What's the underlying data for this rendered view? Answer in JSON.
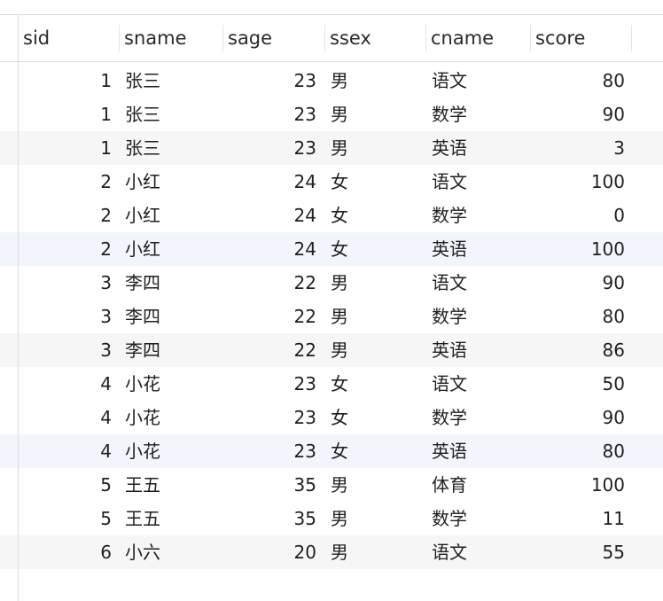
{
  "columns": [
    "sid",
    "sname",
    "sage",
    "ssex",
    "cname",
    "score"
  ],
  "rows": [
    {
      "sid": "1",
      "sname": "张三",
      "sage": "23",
      "ssex": "男",
      "cname": "语文",
      "score": "80"
    },
    {
      "sid": "1",
      "sname": "张三",
      "sage": "23",
      "ssex": "男",
      "cname": "数学",
      "score": "90"
    },
    {
      "sid": "1",
      "sname": "张三",
      "sage": "23",
      "ssex": "男",
      "cname": "英语",
      "score": "3"
    },
    {
      "sid": "2",
      "sname": "小红",
      "sage": "24",
      "ssex": "女",
      "cname": "语文",
      "score": "100"
    },
    {
      "sid": "2",
      "sname": "小红",
      "sage": "24",
      "ssex": "女",
      "cname": "数学",
      "score": "0"
    },
    {
      "sid": "2",
      "sname": "小红",
      "sage": "24",
      "ssex": "女",
      "cname": "英语",
      "score": "100"
    },
    {
      "sid": "3",
      "sname": "李四",
      "sage": "22",
      "ssex": "男",
      "cname": "语文",
      "score": "90"
    },
    {
      "sid": "3",
      "sname": "李四",
      "sage": "22",
      "ssex": "男",
      "cname": "数学",
      "score": "80"
    },
    {
      "sid": "3",
      "sname": "李四",
      "sage": "22",
      "ssex": "男",
      "cname": "英语",
      "score": "86"
    },
    {
      "sid": "4",
      "sname": "小花",
      "sage": "23",
      "ssex": "女",
      "cname": "语文",
      "score": "50"
    },
    {
      "sid": "4",
      "sname": "小花",
      "sage": "23",
      "ssex": "女",
      "cname": "数学",
      "score": "90"
    },
    {
      "sid": "4",
      "sname": "小花",
      "sage": "23",
      "ssex": "女",
      "cname": "英语",
      "score": "80"
    },
    {
      "sid": "5",
      "sname": "王五",
      "sage": "35",
      "ssex": "男",
      "cname": "体育",
      "score": "100"
    },
    {
      "sid": "5",
      "sname": "王五",
      "sage": "35",
      "ssex": "男",
      "cname": "数学",
      "score": "11"
    },
    {
      "sid": "6",
      "sname": "小六",
      "sage": "20",
      "ssex": "男",
      "cname": "语文",
      "score": "55"
    }
  ]
}
